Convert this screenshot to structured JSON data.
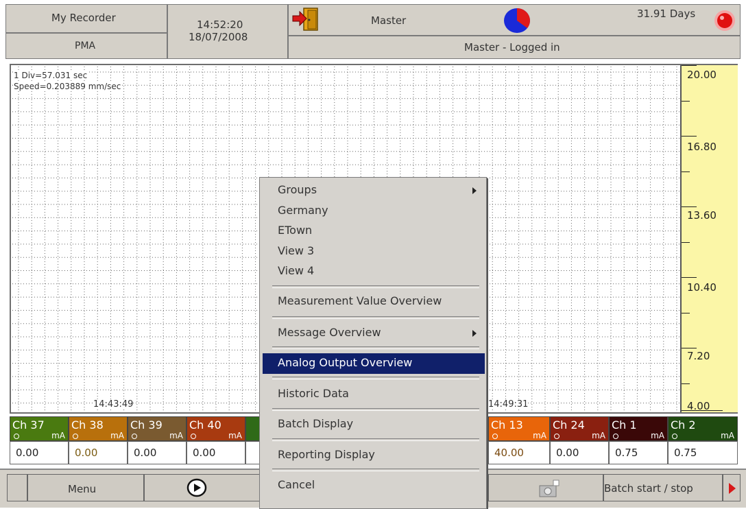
{
  "header": {
    "recorder_name": "My Recorder",
    "recorder_sub": "PMA",
    "time": "14:52:20",
    "date": "18/07/2008",
    "user": "Master",
    "login_status": "Master - Logged in",
    "remaining": "31.91 Days"
  },
  "chart": {
    "div_info": "1 Div=57.031 sec",
    "speed_info": "Speed=0.203889 mm/sec",
    "time_left": "14:43:49",
    "time_right": "14:49:31",
    "scale": [
      "20.00",
      "16.80",
      "13.60",
      "10.40",
      "7.20",
      "4.00"
    ]
  },
  "channels": [
    {
      "name": "Ch 37",
      "unit": "mA",
      "value": "0.00",
      "color": "#4a7a10"
    },
    {
      "name": "Ch 38",
      "unit": "mA",
      "value": "0.00",
      "color": "#b8700c"
    },
    {
      "name": "Ch 39",
      "unit": "mA",
      "value": "0.00",
      "color": "#7a5a30"
    },
    {
      "name": "Ch 40",
      "unit": "mA",
      "value": "0.00",
      "color": "#a83a10"
    },
    {
      "name": "Ch 13",
      "unit": "mA",
      "value": "40.00",
      "color": "#e8650a"
    },
    {
      "name": "Ch 24",
      "unit": "mA",
      "value": "0.00",
      "color": "#8a2010"
    },
    {
      "name": "Ch 1",
      "unit": "mA",
      "value": "0.75",
      "color": "#3a0808"
    },
    {
      "name": "Ch 2",
      "unit": "mA",
      "value": "0.75",
      "color": "#1f4a10"
    }
  ],
  "bottom_bar": {
    "menu_label": "Menu",
    "batch_label": "Batch start / stop"
  },
  "context_menu": {
    "items": [
      {
        "label": "Groups",
        "submenu": true
      },
      {
        "label": "Germany"
      },
      {
        "label": "ETown"
      },
      {
        "label": "View 3"
      },
      {
        "label": "View 4"
      },
      {
        "label": "Measurement Value Overview"
      },
      {
        "label": "Message Overview",
        "submenu": true
      },
      {
        "label": "Analog Output Overview",
        "highlighted": true
      },
      {
        "label": "Historic Data"
      },
      {
        "label": "Batch Display"
      },
      {
        "label": "Reporting Display"
      },
      {
        "label": "Cancel"
      }
    ]
  }
}
